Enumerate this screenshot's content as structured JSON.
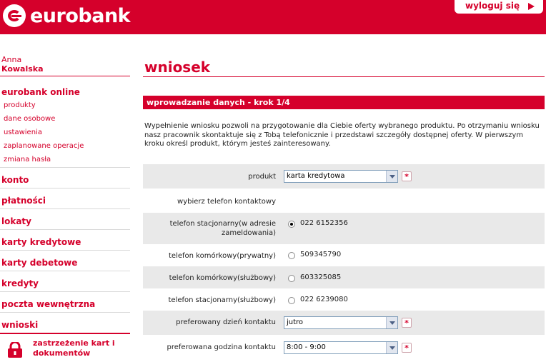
{
  "header": {
    "brand": "eurobank",
    "logout_label": "wyloguj się"
  },
  "user": {
    "first_name": "Anna",
    "last_name": "Kowalska"
  },
  "sidebar": {
    "online_title": "eurobank online",
    "online_items": [
      "produkty",
      "dane osobowe",
      "ustawienia",
      "zaplanowane operacje",
      "zmiana hasła"
    ],
    "sections": [
      "konto",
      "płatności",
      "lokaty",
      "karty kredytowe",
      "karty debetowe",
      "kredyty",
      "poczta wewnętrzna",
      "wnioski"
    ],
    "lock_label_1": "zastrzeżenie kart i",
    "lock_label_2": "dokumentów"
  },
  "main": {
    "title": "wniosek",
    "step": "wprowadzanie danych - krok 1/4",
    "intro": "Wypełnienie wniosku pozwoli na przygotowanie dla Ciebie oferty wybranego produktu. Po otrzymaniu wniosku nasz pracownik skontaktuje się z Tobą telefonicznie i przedstawi szczegóły dostępnej oferty. W pierwszym kroku określ produkt, którym jesteś zainteresowany."
  },
  "form": {
    "product_label": "produkt",
    "product_value": "karta kredytowa",
    "choose_phone_label": "wybierz telefon kontaktowy",
    "phones": [
      {
        "label": "telefon stacjonarny(w adresie zameldowania)",
        "number": "022 6152356",
        "selected": true
      },
      {
        "label": "telefon komórkowy(prywatny)",
        "number": "509345790",
        "selected": false
      },
      {
        "label": "telefon komórkowy(służbowy)",
        "number": "603325085",
        "selected": false
      },
      {
        "label": "telefon stacjonarny(służbowy)",
        "number": "022 6239080",
        "selected": false
      }
    ],
    "phone_label_0a": "telefon stacjonarny(w adresie",
    "phone_label_0b": "zameldowania)",
    "day_label": "preferowany dzień kontaktu",
    "day_value": "jutro",
    "hour_label": "preferowana godzina kontaktu",
    "hour_value": "8:00 - 9:00",
    "required_mark": "*"
  },
  "colors": {
    "brand_red": "#d5002b",
    "row_shade": "#e9e9e9"
  },
  "icons": [
    "lock-icon",
    "chevron-down-icon",
    "arrow-right-icon"
  ]
}
